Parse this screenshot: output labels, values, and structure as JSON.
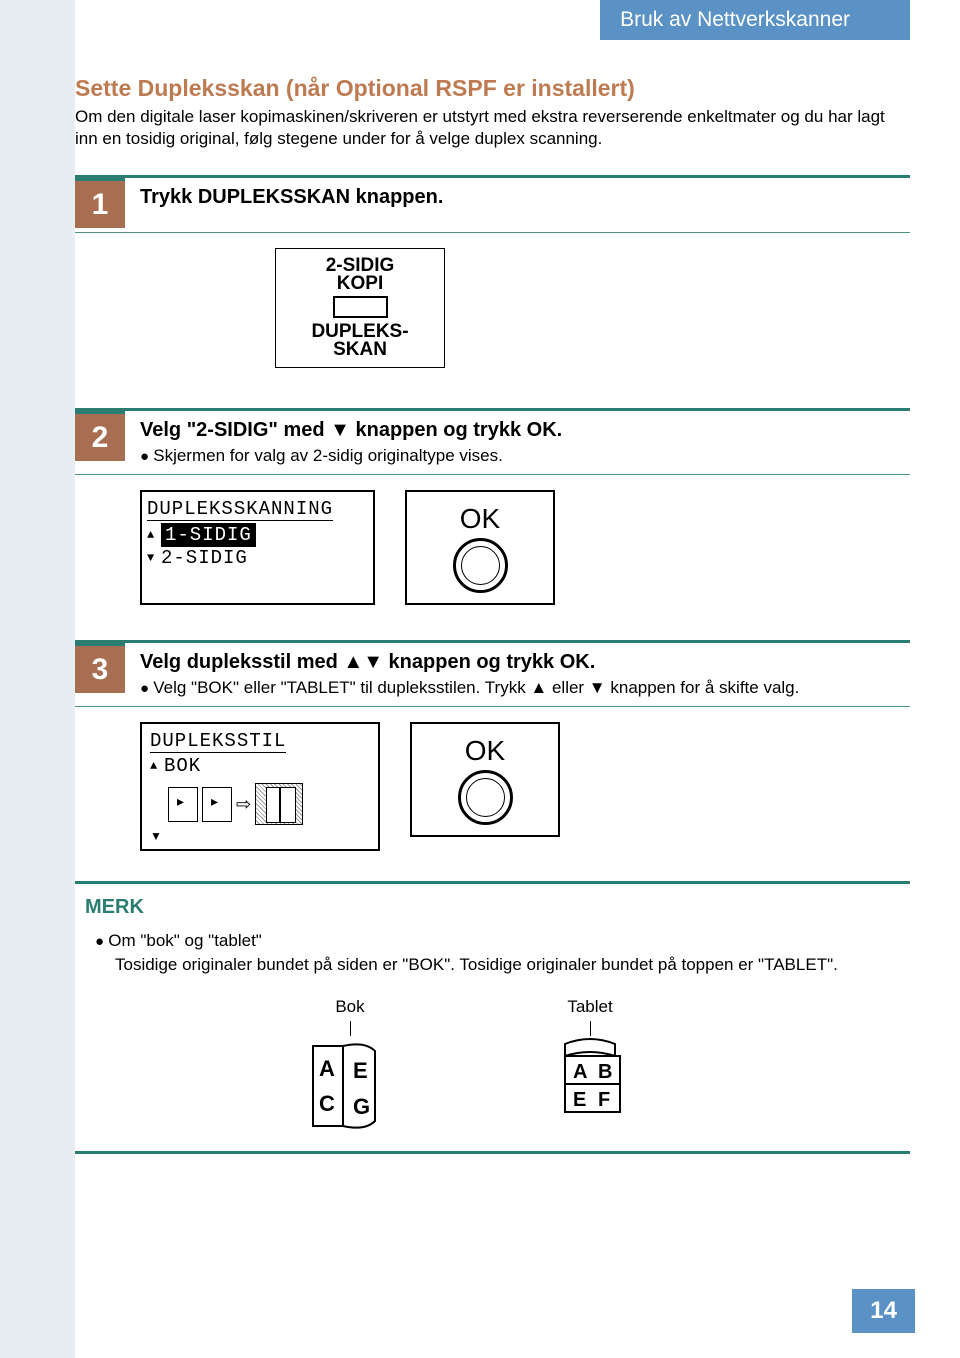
{
  "header": {
    "tab_title": "Bruk av Nettverkskanner"
  },
  "section": {
    "title": "Sette Dupleksskan (når Optional RSPF er installert)",
    "intro": "Om den digitale laser kopimaskinen/skriveren er utstyrt med ekstra reverserende enkeltmater og du har lagt inn en tosidig original, følg stegene under for å velge duplex scanning."
  },
  "step1": {
    "number": "1",
    "title": "Trykk DUPLEKSSKAN knappen.",
    "display": {
      "top_label": "2-SIDIG KOPI",
      "bottom_label": "DUPLEKS- SKAN"
    }
  },
  "step2": {
    "number": "2",
    "title": "Velg \"2-SIDIG\" med ▼ knappen og trykk OK.",
    "bullet": "Skjermen for valg av 2-sidig originaltype vises.",
    "lcd_title": "DUPLEKSSKANNING",
    "lcd_line1": "1-SIDIG",
    "lcd_line2": "2-SIDIG",
    "ok_label": "OK"
  },
  "step3": {
    "number": "3",
    "title": "Velg dupleksstil med ▲▼ knappen og trykk OK.",
    "bullet": "Velg \"BOK\" eller \"TABLET\" til dupleksstilen. Trykk ▲ eller ▼ knappen for å skifte valg.",
    "lcd_title": "DUPLEKSSTIL",
    "lcd_line1": "BOK",
    "ok_label": "OK"
  },
  "note": {
    "title": "MERK",
    "heading": "Om \"bok\" og \"tablet\"",
    "body": "Tosidige originaler bundet på siden er \"BOK\". Tosidige originaler bundet på toppen er \"TABLET\".",
    "bok_label": "Bok",
    "tablet_label": "Tablet"
  },
  "page_number": "14"
}
